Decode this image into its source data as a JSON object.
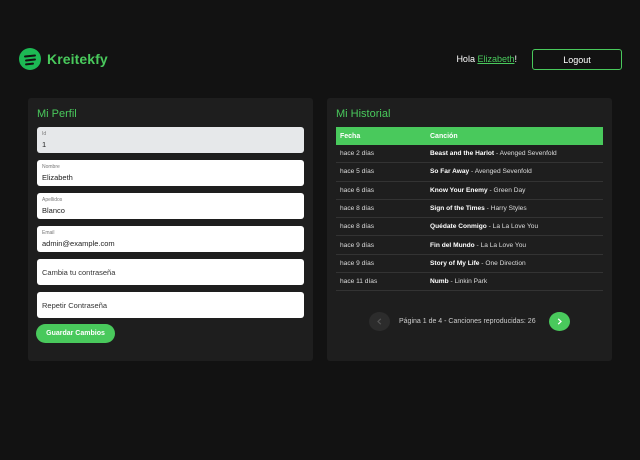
{
  "header": {
    "brand": "Kreitekfy",
    "greeting_prefix": "Hola ",
    "user_name": "Elizabeth",
    "greeting_suffix": "!",
    "logout_label": "Logout",
    "accent_color": "#49c95c"
  },
  "profile": {
    "title": "Mi Perfil",
    "fields": [
      {
        "label": "Id",
        "value": "1"
      },
      {
        "label": "Nombre",
        "value": "Elizabeth"
      },
      {
        "label": "Apellidos",
        "value": "Blanco"
      },
      {
        "label": "Email",
        "value": "admin@example.com"
      }
    ],
    "password_placeholder": "Cambia tu contraseña",
    "repeat_password_placeholder": "Repetir Contraseña",
    "save_label": "Guardar Cambios"
  },
  "history": {
    "title": "Mi Historial",
    "columns": [
      "Fecha",
      "Canción"
    ],
    "rows": [
      {
        "date": "hace 2 días",
        "song": "Beast and the Harlot",
        "artist": "Avenged Sevenfold"
      },
      {
        "date": "hace 5 días",
        "song": "So Far Away",
        "artist": "Avenged Sevenfold"
      },
      {
        "date": "hace 6 días",
        "song": "Know Your Enemy",
        "artist": "Green Day"
      },
      {
        "date": "hace 8 días",
        "song": "Sign of the Times",
        "artist": "Harry Styles"
      },
      {
        "date": "hace 8 días",
        "song": "Quédate Conmigo",
        "artist": "La La Love You"
      },
      {
        "date": "hace 9 días",
        "song": "Fin del Mundo",
        "artist": "La La Love You"
      },
      {
        "date": "hace 9 días",
        "song": "Story of My Life",
        "artist": "One Direction"
      },
      {
        "date": "hace 11 días",
        "song": "Numb",
        "artist": "Linkin Park"
      }
    ],
    "separator": " - ",
    "pagination_text": "Página 1 de 4 - Canciones reproducidas: 26",
    "prev_icon": "chevron-left-icon",
    "next_icon": "chevron-right-icon"
  }
}
